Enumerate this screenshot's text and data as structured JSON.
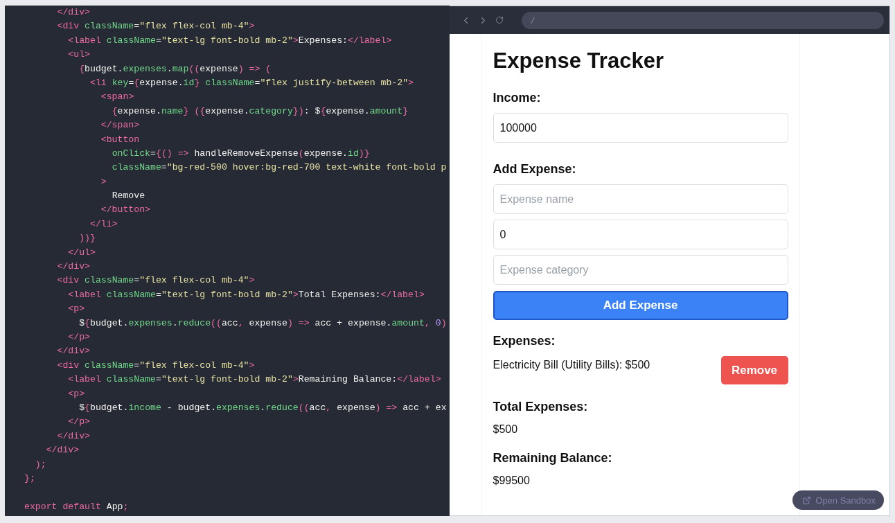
{
  "editor": {
    "code": "      </div>\n      <div className=\"flex flex-col mb-4\">\n        <label className=\"text-lg font-bold mb-2\">Expenses:</label>\n        <ul>\n          {budget.expenses.map((expense) => (\n            <li key={expense.id} className=\"flex justify-between mb-2\">\n              <span>\n                {expense.name} ({expense.category}): ${expense.amount}\n              </span>\n              <button\n                onClick={() => handleRemoveExpense(expense.id)}\n                className=\"bg-red-500 hover:bg-red-700 text-white font-bold p\n              >\n                Remove\n              </button>\n            </li>\n          ))}\n        </ul>\n      </div>\n      <div className=\"flex flex-col mb-4\">\n        <label className=\"text-lg font-bold mb-2\">Total Expenses:</label>\n        <p>\n          ${budget.expenses.reduce((acc, expense) => acc + expense.amount, 0)\n        </p>\n      </div>\n      <div className=\"flex flex-col mb-4\">\n        <label className=\"text-lg font-bold mb-2\">Remaining Balance:</label>\n        <p>\n          ${budget.income - budget.expenses.reduce((acc, expense) => acc + ex\n        </p>\n      </div>\n    </div>\n  );\n};\n\nexport default App;"
  },
  "browser": {
    "address": "/"
  },
  "app": {
    "title": "Expense Tracker",
    "income": {
      "label": "Income:",
      "value": "100000"
    },
    "add_expense": {
      "label": "Add Expense:",
      "fields": [
        {
          "placeholder": "Expense name"
        },
        {
          "value": "0"
        },
        {
          "placeholder": "Expense category"
        }
      ],
      "button": "Add Expense"
    },
    "expenses": {
      "label": "Expenses:",
      "items": [
        {
          "text": "Electricity Bill (Utility Bills): $500",
          "button": "Remove"
        }
      ]
    },
    "total": {
      "label": "Total Expenses:",
      "value": "$500"
    },
    "balance": {
      "label": "Remaining Balance:",
      "value": "$99500"
    }
  },
  "open_sandbox": {
    "label": "Open Sandbox"
  }
}
